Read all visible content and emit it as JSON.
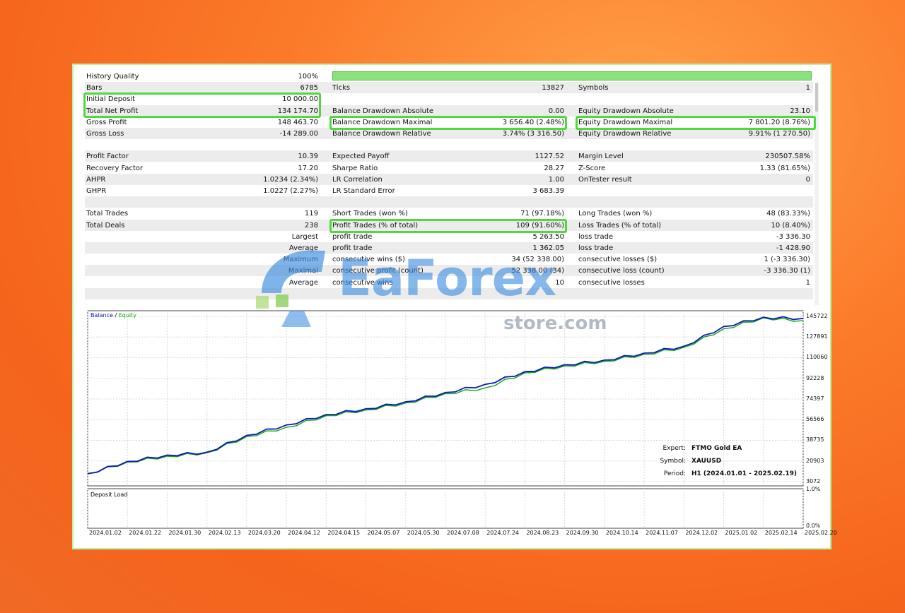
{
  "report": {
    "rows": [
      {
        "c1": [
          "History Quality",
          "100%"
        ],
        "c2": null,
        "c3": null
      },
      {
        "c1": [
          "Bars",
          "6785"
        ],
        "c2": [
          "Ticks",
          "13827"
        ],
        "c3": [
          "Symbols",
          "1"
        ]
      },
      {
        "c1": [
          "Initial Deposit",
          "10 000.00"
        ],
        "c2": null,
        "c3": null
      },
      {
        "c1": [
          "Total Net Profit",
          "134 174.70"
        ],
        "c2": [
          "Balance Drawdown Absolute",
          "0.00"
        ],
        "c3": [
          "Equity Drawdown Absolute",
          "23.10"
        ]
      },
      {
        "c1": [
          "Gross Profit",
          "148 463.70"
        ],
        "c2": [
          "Balance Drawdown Maximal",
          "3 656.40 (2.48%)"
        ],
        "c3": [
          "Equity Drawdown Maximal",
          "7 801.20 (8.76%)"
        ]
      },
      {
        "c1": [
          "Gross Loss",
          "-14 289.00"
        ],
        "c2": [
          "Balance Drawdown Relative",
          "3.74% (3 316.50)"
        ],
        "c3": [
          "Equity Drawdown Relative",
          "9.91% (1 270.50)"
        ]
      },
      {
        "c1": null,
        "c2": null,
        "c3": null
      },
      {
        "c1": [
          "Profit Factor",
          "10.39"
        ],
        "c2": [
          "Expected Payoff",
          "1127.52"
        ],
        "c3": [
          "Margin Level",
          "230507.58%"
        ]
      },
      {
        "c1": [
          "Recovery Factor",
          "17.20"
        ],
        "c2": [
          "Sharpe Ratio",
          "28.27"
        ],
        "c3": [
          "Z-Score",
          "1.33 (81.65%)"
        ]
      },
      {
        "c1": [
          "AHPR",
          "1.0234 (2.34%)"
        ],
        "c2": [
          "LR Correlation",
          "1.00"
        ],
        "c3": [
          "OnTester result",
          "0"
        ]
      },
      {
        "c1": [
          "GHPR",
          "1.0227 (2.27%)"
        ],
        "c2": [
          "LR Standard Error",
          "3 683.39"
        ],
        "c3": null
      },
      {
        "c1": null,
        "c2": null,
        "c3": null
      },
      {
        "c1": [
          "Total Trades",
          "119"
        ],
        "c2": [
          "Short Trades (won %)",
          "71 (97.18%)"
        ],
        "c3": [
          "Long Trades (won %)",
          "48 (83.33%)"
        ]
      },
      {
        "c1": [
          "Total Deals",
          "238"
        ],
        "c2": [
          "Profit Trades (% of total)",
          "109 (91.60%)"
        ],
        "c3": [
          "Loss Trades (% of total)",
          "10 (8.40%)"
        ]
      },
      {
        "r1": "Largest",
        "c2": [
          "profit trade",
          "5 263.50"
        ],
        "c3": [
          "loss trade",
          "-3 336.30"
        ]
      },
      {
        "r1": "Average",
        "c2": [
          "profit trade",
          "1 362.05"
        ],
        "c3": [
          "loss trade",
          "-1 428.90"
        ]
      },
      {
        "r1": "Maximum",
        "c2": [
          "consecutive wins ($)",
          "34 (52 338.00)"
        ],
        "c3": [
          "consecutive losses ($)",
          "1 (-3 336.30)"
        ]
      },
      {
        "r1": "Maximal",
        "c2": [
          "consecutive profit (count)",
          "52 338.00 (34)"
        ],
        "c3": [
          "consecutive loss (count)",
          "-3 336.30 (1)"
        ]
      },
      {
        "r1": "Average",
        "c2": [
          "consecutive wins",
          "10"
        ],
        "c3": [
          "consecutive losses",
          "1"
        ]
      },
      {
        "c1": null,
        "c2": null,
        "c3": null
      }
    ]
  },
  "chart": {
    "legend_balance": "Balance",
    "legend_sep": " / ",
    "legend_equity": "Equity",
    "deposit_load_label": "Deposit Load",
    "info": {
      "expert_key": "Expert:",
      "expert_val": "FTMO Gold EA",
      "symbol_key": "Symbol:",
      "symbol_val": "XAUUSD",
      "period_key": "Period:",
      "period_val": "H1 (2024.01.01 - 2025.02.19)"
    }
  },
  "chart_data": {
    "type": "line",
    "x": [
      "2024.01.02",
      "2024.01.22",
      "2024.01.30",
      "2024.02.13",
      "2024.03.20",
      "2024.04.12",
      "2024.04.15",
      "2024.05.07",
      "2024.05.30",
      "2024.07.08",
      "2024.07.24",
      "2024.08.23",
      "2024.09.30",
      "2024.10.14",
      "2024.11.07",
      "2024.12.02",
      "2025.01.02",
      "2025.02.14",
      "2025.02.20"
    ],
    "y_ticks": [
      "145722",
      "127891",
      "110060",
      "92228",
      "74397",
      "56566",
      "38735",
      "20903",
      "3072"
    ],
    "ylim": [
      3072,
      145722
    ],
    "series": [
      {
        "name": "Balance",
        "color": "#0a1bb5",
        "values": [
          10000,
          20500,
          26000,
          28500,
          43000,
          52000,
          61000,
          66000,
          72000,
          80000,
          87000,
          98000,
          104000,
          108000,
          114000,
          120000,
          137000,
          145000,
          144000
        ]
      },
      {
        "name": "Equity",
        "color": "#10a810",
        "values": [
          9800,
          20000,
          25000,
          28000,
          42000,
          50000,
          60000,
          65000,
          71000,
          79000,
          84000,
          97000,
          103000,
          107000,
          113000,
          119000,
          135000,
          144500,
          142000
        ]
      }
    ],
    "deposit_load": {
      "ylim_labels": [
        "1.0%",
        "0.0%"
      ]
    }
  },
  "watermark": {
    "brand": "EaForex",
    "domain": "store.com"
  }
}
